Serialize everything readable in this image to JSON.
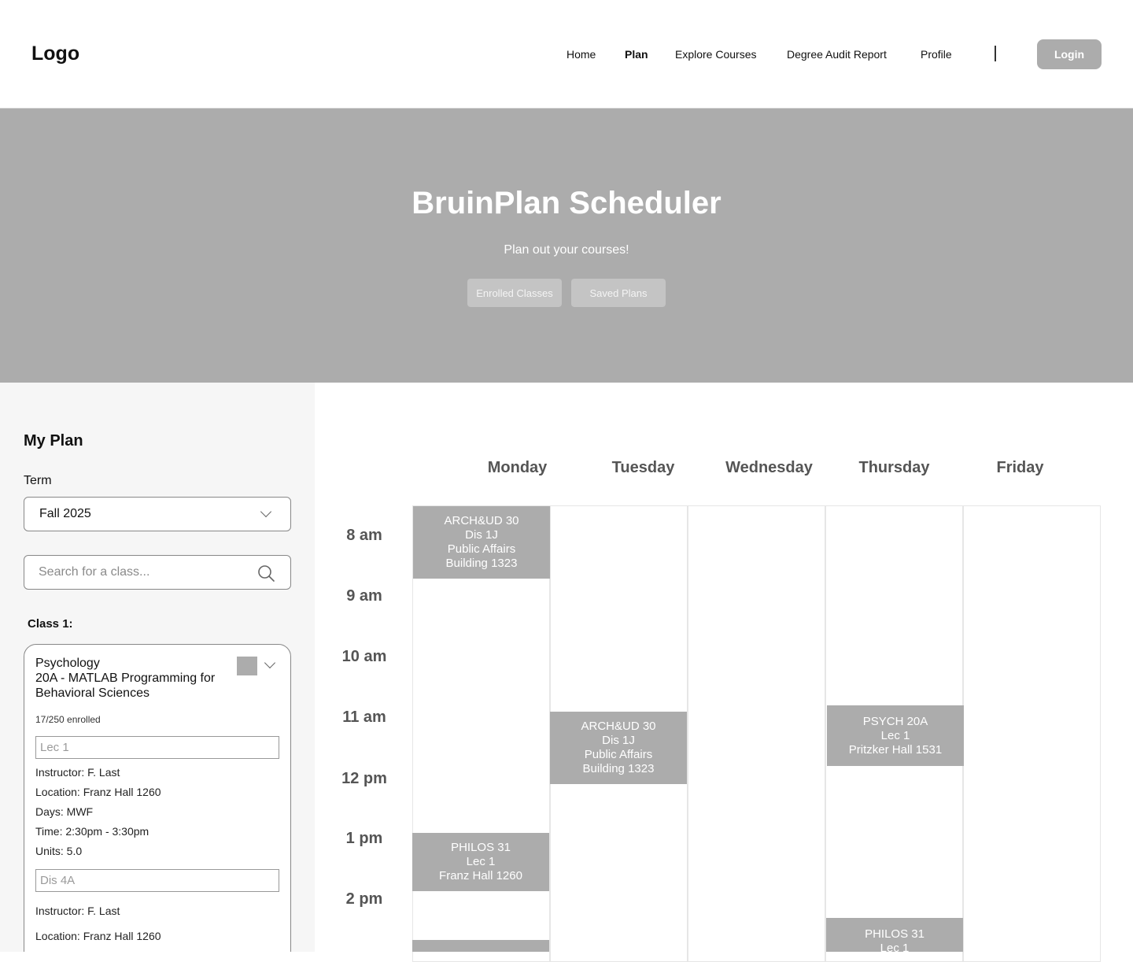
{
  "header": {
    "logo": "Logo",
    "nav": [
      "Home",
      "Plan",
      "Explore Courses",
      "Degree Audit Report",
      "Profile"
    ],
    "login": "Login"
  },
  "hero": {
    "title": "BruinPlan Scheduler",
    "subtitle": "Plan out your courses!",
    "buttons": [
      "Enrolled Classes",
      "Saved Plans"
    ]
  },
  "sidebar": {
    "title": "My Plan",
    "term_label": "Term",
    "term_value": "Fall 2025",
    "search_placeholder": "Search for a class...",
    "class_label": "Class 1:",
    "class": {
      "title_line1": "Psychology",
      "title_line2": "20A - MATLAB Programming for",
      "title_line3": "Behavioral Sciences",
      "swatch_color": "#acacac",
      "enrolled": "17/250 enrolled",
      "lecture_field": "Lec 1",
      "lecture": {
        "instructor": "Instructor: F. Last",
        "location": "Location: Franz Hall 1260",
        "days": "Days: MWF",
        "time": "Time: 2:30pm - 3:30pm",
        "units": "Units: 5.0"
      },
      "discussion_field": "Dis 4A",
      "discussion": {
        "instructor": "Instructor: F. Last",
        "location": "Location: Franz Hall 1260"
      }
    }
  },
  "calendar": {
    "days": [
      "Monday",
      "Tuesday",
      "Wednesday",
      "Thursday",
      "Friday"
    ],
    "times": [
      "8 am",
      "9 am",
      "10 am",
      "11 am",
      "12 pm",
      "1 pm",
      "2 pm"
    ],
    "events": {
      "mon_arch": [
        "ARCH&UD 30",
        "Dis 1J",
        "Public Affairs",
        "Building 1323"
      ],
      "mon_philos": [
        "PHILOS 31",
        "Lec 1",
        "Franz Hall 1260"
      ],
      "tue_arch": [
        "ARCH&UD 30",
        "Dis 1J",
        "Public Affairs",
        "Building 1323"
      ],
      "thu_psych": [
        "PSYCH 20A",
        "Lec 1",
        "Pritzker Hall 1531"
      ],
      "thu_philos": [
        "PHILOS 31",
        "Lec 1"
      ]
    },
    "event_color": "#acacac"
  }
}
